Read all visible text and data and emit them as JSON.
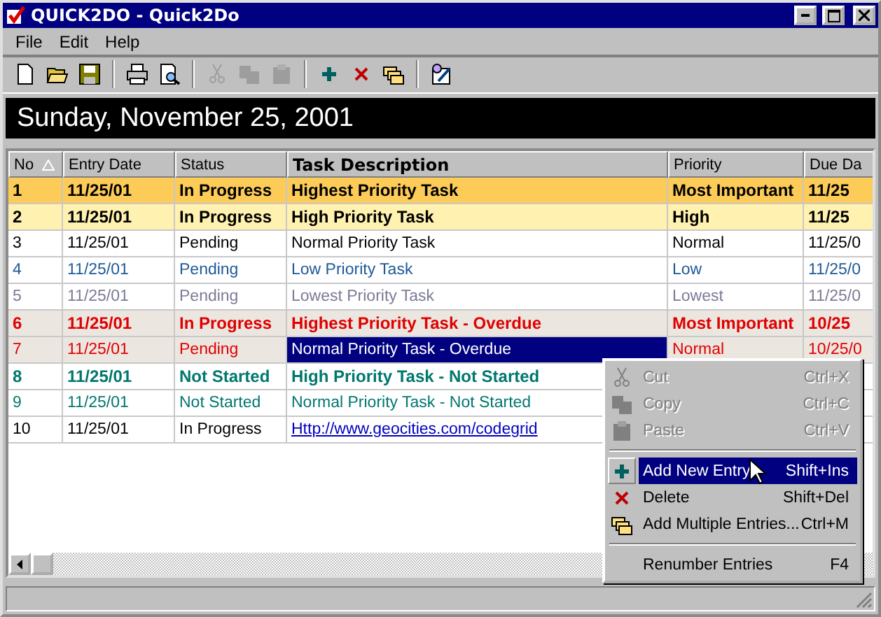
{
  "window": {
    "title": "QUICK2DO - Quick2Do"
  },
  "menu": [
    "File",
    "Edit",
    "Help"
  ],
  "toolbar": [
    {
      "kind": "new",
      "disabled": false
    },
    {
      "kind": "open",
      "disabled": false
    },
    {
      "kind": "save",
      "disabled": false
    },
    {
      "kind": "separator"
    },
    {
      "kind": "print",
      "disabled": false
    },
    {
      "kind": "preview",
      "disabled": false
    },
    {
      "kind": "separator"
    },
    {
      "kind": "cut",
      "disabled": true
    },
    {
      "kind": "copy",
      "disabled": true
    },
    {
      "kind": "paste",
      "disabled": true
    },
    {
      "kind": "separator"
    },
    {
      "kind": "add",
      "disabled": false
    },
    {
      "kind": "delete",
      "disabled": false
    },
    {
      "kind": "multiple",
      "disabled": false
    },
    {
      "kind": "separator"
    },
    {
      "kind": "properties",
      "disabled": false
    }
  ],
  "date_banner": "Sunday, November 25, 2001",
  "table": {
    "columns": [
      {
        "label": "No",
        "sorted": true
      },
      {
        "label": "Entry Date",
        "sorted": false
      },
      {
        "label": "Status",
        "sorted": false
      },
      {
        "label": "Task Description",
        "sorted": false
      },
      {
        "label": "Priority",
        "sorted": false
      },
      {
        "label": "Due Da",
        "sorted": false
      }
    ],
    "rows": [
      {
        "kind": "highest",
        "task_selected": false,
        "cells": [
          "1",
          "11/25/01",
          "In Progress",
          "Highest Priority Task",
          "Most Important",
          "11/25"
        ]
      },
      {
        "kind": "high",
        "task_selected": false,
        "cells": [
          "2",
          "11/25/01",
          "In Progress",
          "High Priority Task",
          "High",
          "11/25"
        ]
      },
      {
        "kind": "normal",
        "task_selected": false,
        "cells": [
          "3",
          "11/25/01",
          "Pending",
          "Normal Priority Task",
          "Normal",
          "11/25/0"
        ]
      },
      {
        "kind": "low",
        "task_selected": false,
        "cells": [
          "4",
          "11/25/01",
          "Pending",
          "Low Priority Task",
          "Low",
          "11/25/0"
        ]
      },
      {
        "kind": "lowest",
        "task_selected": false,
        "cells": [
          "5",
          "11/25/01",
          "Pending",
          "Lowest Priority Task",
          "Lowest",
          "11/25/0"
        ]
      },
      {
        "kind": "overdue-highest",
        "task_selected": false,
        "cells": [
          "6",
          "11/25/01",
          "In Progress",
          "Highest Priority Task - Overdue",
          "Most Important",
          "10/25"
        ]
      },
      {
        "kind": "overdue-normal",
        "task_selected": true,
        "cells": [
          "7",
          "11/25/01",
          "Pending",
          "Normal Priority Task - Overdue",
          "Normal",
          "10/25/0"
        ]
      },
      {
        "kind": "started-high",
        "task_selected": false,
        "cells": [
          "8",
          "11/25/01",
          "Not Started",
          "High Priority Task - Not Started"
        ]
      },
      {
        "kind": "started-normal",
        "task_selected": false,
        "cells": [
          "9",
          "11/25/01",
          "Not Started",
          "Normal Priority Task - Not Started"
        ]
      },
      {
        "kind": "link",
        "task_selected": false,
        "cells": [
          "10",
          "11/25/01",
          "In Progress",
          "Http://www.geocities.com/codegrid"
        ]
      }
    ]
  },
  "context_menu": [
    {
      "kind": "cut",
      "label": "Cut",
      "shortcut": "Ctrl+X",
      "disabled": true,
      "selected": false
    },
    {
      "kind": "copy",
      "label": "Copy",
      "shortcut": "Ctrl+C",
      "disabled": true,
      "selected": false
    },
    {
      "kind": "paste",
      "label": "Paste",
      "shortcut": "Ctrl+V",
      "disabled": true,
      "selected": false
    },
    {
      "kind": "separator"
    },
    {
      "kind": "add",
      "label": "Add New Entry",
      "shortcut": "Shift+Ins",
      "disabled": false,
      "selected": true
    },
    {
      "kind": "delete",
      "label": "Delete",
      "shortcut": "Shift+Del",
      "disabled": false,
      "selected": false
    },
    {
      "kind": "multiple",
      "label": "Add Multiple Entries...",
      "shortcut": "Ctrl+M",
      "disabled": false,
      "selected": false
    },
    {
      "kind": "separator"
    },
    {
      "kind": "plain",
      "label": "Renumber Entries",
      "shortcut": "F4",
      "disabled": false,
      "selected": false
    }
  ]
}
